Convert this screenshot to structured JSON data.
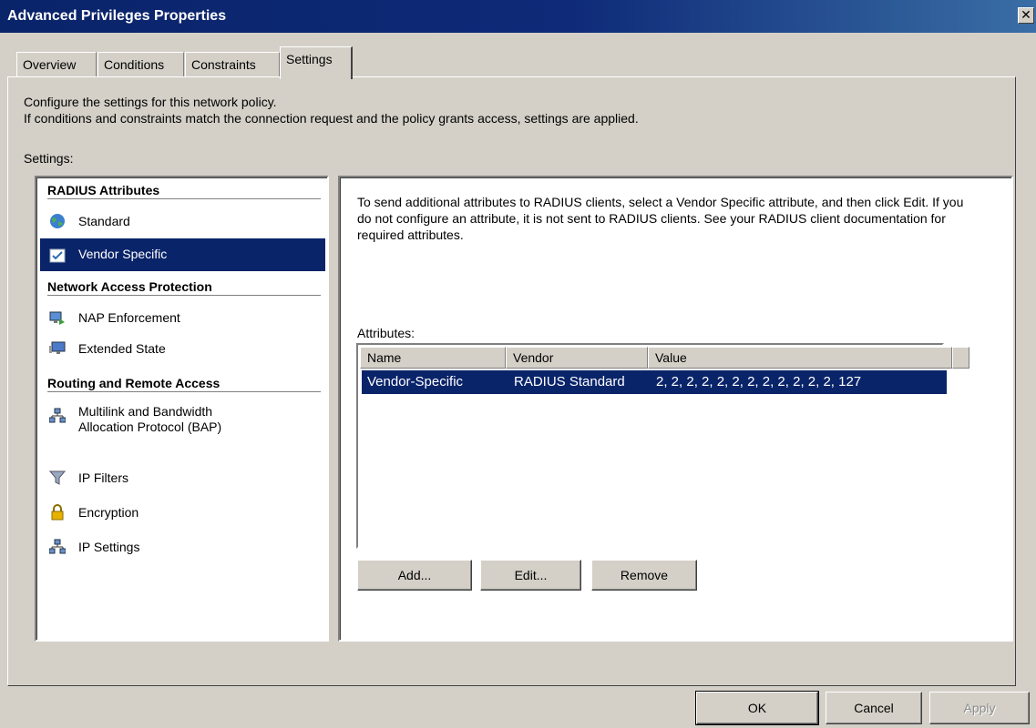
{
  "window": {
    "title": "Advanced Privileges Properties"
  },
  "tabs": [
    "Overview",
    "Conditions",
    "Constraints",
    "Settings"
  ],
  "active_tab": "Settings",
  "description": {
    "line1": "Configure the settings for this network policy.",
    "line2": "If conditions and constraints match the connection request and the policy grants access, settings are applied."
  },
  "settings_label": "Settings:",
  "groups": [
    {
      "header": "RADIUS Attributes",
      "items": [
        {
          "label": "Standard",
          "icon": "globe-icon"
        },
        {
          "label": "Vendor Specific",
          "icon": "checkbox-icon",
          "selected": true
        }
      ]
    },
    {
      "header": "Network Access Protection",
      "items": [
        {
          "label": "NAP Enforcement",
          "icon": "nap-icon"
        },
        {
          "label": "Extended State",
          "icon": "monitor-icon"
        }
      ]
    },
    {
      "header": "Routing and Remote Access",
      "items": [
        {
          "label": "Multilink and Bandwidth",
          "label2": "Allocation Protocol (BAP)",
          "icon": "network-icon"
        },
        {
          "label": "IP Filters",
          "icon": "filter-icon"
        },
        {
          "label": "Encryption",
          "icon": "lock-icon"
        },
        {
          "label": "IP Settings",
          "icon": "network-icon"
        }
      ]
    }
  ],
  "right_panel": {
    "text": "To send additional attributes to RADIUS clients, select a Vendor Specific attribute, and then click Edit. If you do not configure an attribute, it is not sent to RADIUS clients. See your RADIUS client documentation for required attributes.",
    "attributes_label": "Attributes:",
    "columns": [
      "Name",
      "Vendor",
      "Value"
    ],
    "rows": [
      {
        "name": "Vendor-Specific",
        "vendor": "RADIUS Standard",
        "value": "2, 2, 2, 2, 2, 2, 2, 2, 2, 2, 2, 2, 127"
      }
    ],
    "buttons": {
      "add": "Add...",
      "edit": "Edit...",
      "remove": "Remove"
    }
  },
  "footer_buttons": {
    "ok": "OK",
    "cancel": "Cancel",
    "apply": "Apply"
  },
  "colors": {
    "titlebar": "#0a246a",
    "selection": "#0a246a",
    "face": "#d4d0c8"
  }
}
